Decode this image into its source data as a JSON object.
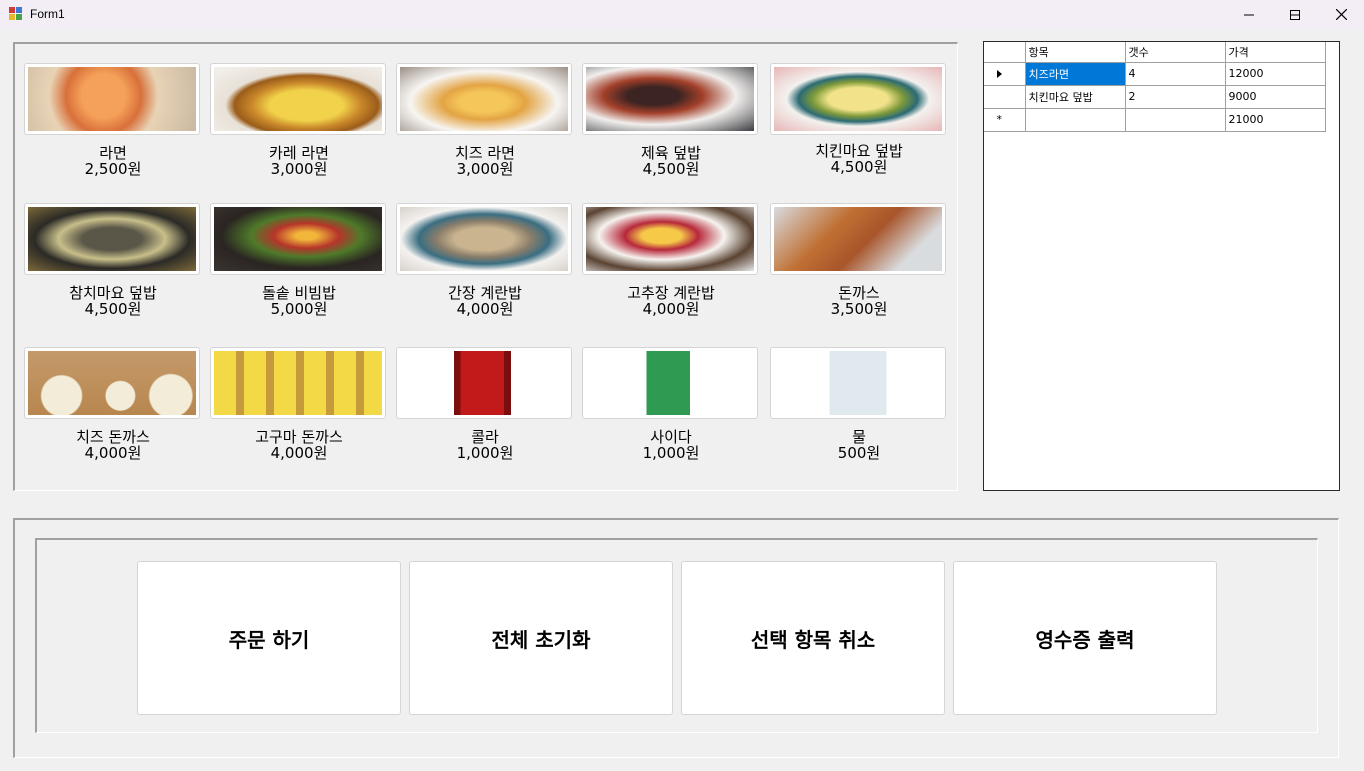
{
  "window": {
    "title": "Form1"
  },
  "menu": [
    {
      "name": "라면",
      "price": "2,500원",
      "image": "ramen"
    },
    {
      "name": "카레 라면",
      "price": "3,000원",
      "image": "curry-ramen"
    },
    {
      "name": "치즈 라면",
      "price": "3,000원",
      "image": "cheese-ramen"
    },
    {
      "name": "제육 덮밥",
      "price": "4,500원",
      "image": "jeyuk-bowl"
    },
    {
      "name": "치킨마요 덮밥",
      "price": "4,500원",
      "image": "chicken-mayo-bowl"
    },
    {
      "name": "참치마요 덮밥",
      "price": "4,500원",
      "image": "tuna-mayo-bowl"
    },
    {
      "name": "돌솥 비빔밥",
      "price": "5,000원",
      "image": "dolsot-bibimbap"
    },
    {
      "name": "간장 계란밥",
      "price": "4,000원",
      "image": "soy-egg-rice"
    },
    {
      "name": "고추장 계란밥",
      "price": "4,000원",
      "image": "gochujang-egg-rice"
    },
    {
      "name": "돈까스",
      "price": "3,500원",
      "image": "tonkatsu"
    },
    {
      "name": "치즈 돈까스",
      "price": "4,000원",
      "image": "cheese-tonkatsu"
    },
    {
      "name": "고구마 돈까스",
      "price": "4,000원",
      "image": "sweet-potato-tonkatsu"
    },
    {
      "name": "콜라",
      "price": "1,000원",
      "image": "cola"
    },
    {
      "name": "사이다",
      "price": "1,000원",
      "image": "cider"
    },
    {
      "name": "물",
      "price": "500원",
      "image": "water"
    }
  ],
  "order_grid": {
    "columns": [
      "항목",
      "갯수",
      "가격"
    ],
    "rows": [
      {
        "item": "치즈라면",
        "qty": "4",
        "price": "12000",
        "selected": true
      },
      {
        "item": "치킨마요 덮밥",
        "qty": "2",
        "price": "9000",
        "selected": false
      }
    ],
    "new_row": {
      "item": "",
      "qty": "",
      "price": "21000"
    }
  },
  "actions": {
    "order": "주문 하기",
    "reset_all": "전체 초기화",
    "cancel_selected": "선택 항목 취소",
    "print_receipt": "영수증 출력"
  },
  "colors": {
    "titlebar": "#f3eef5",
    "form_bg": "#f0f0f0",
    "selection": "#0078d7"
  }
}
